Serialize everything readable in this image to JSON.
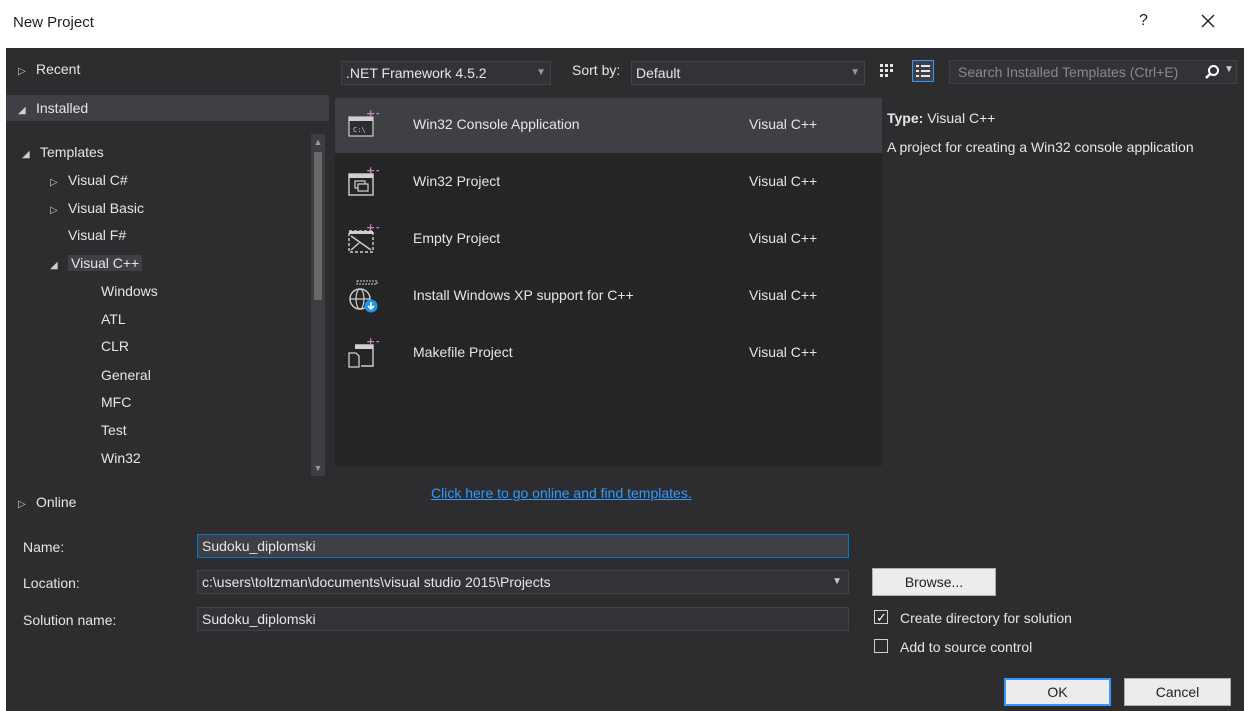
{
  "window": {
    "title": "New Project",
    "help": "?"
  },
  "tree": {
    "recent": "Recent",
    "installed": "Installed",
    "templates": "Templates",
    "visual_csharp": "Visual C#",
    "visual_basic": "Visual Basic",
    "visual_fsharp": "Visual F#",
    "visual_cpp": "Visual C++",
    "cpp_children": [
      "Windows",
      "ATL",
      "CLR",
      "General",
      "MFC",
      "Test",
      "Win32"
    ],
    "online": "Online"
  },
  "toolbar": {
    "framework": ".NET Framework 4.5.2",
    "sort_label": "Sort by:",
    "sort_value": "Default",
    "search_placeholder": "Search Installed Templates (Ctrl+E)"
  },
  "templates": [
    {
      "name": "Win32 Console Application",
      "lang": "Visual C++",
      "icon": "console-app-icon"
    },
    {
      "name": "Win32 Project",
      "lang": "Visual C++",
      "icon": "win32-project-icon"
    },
    {
      "name": "Empty Project",
      "lang": "Visual C++",
      "icon": "empty-project-icon"
    },
    {
      "name": "Install Windows XP support for C++",
      "lang": "Visual C++",
      "icon": "globe-download-icon"
    },
    {
      "name": "Makefile Project",
      "lang": "Visual C++",
      "icon": "makefile-project-icon"
    }
  ],
  "online_link": "Click here to go online and find templates.",
  "details": {
    "type_label": "Type:",
    "type_value": "Visual C++",
    "description": "A project for creating a Win32 console application"
  },
  "form": {
    "name_label": "Name:",
    "name_value": "Sudoku_diplomski",
    "location_label": "Location:",
    "location_value": "c:\\users\\toltzman\\documents\\visual studio 2015\\Projects",
    "solution_label": "Solution name:",
    "solution_value": "Sudoku_diplomski",
    "browse": "Browse...",
    "create_dir": "Create directory for solution",
    "create_dir_checked": true,
    "source_control": "Add to source control",
    "source_control_checked": false,
    "ok": "OK",
    "cancel": "Cancel"
  },
  "colors": {
    "accent": "#007acc",
    "link": "#3399ff",
    "cpp_badge": "#c586c0"
  }
}
